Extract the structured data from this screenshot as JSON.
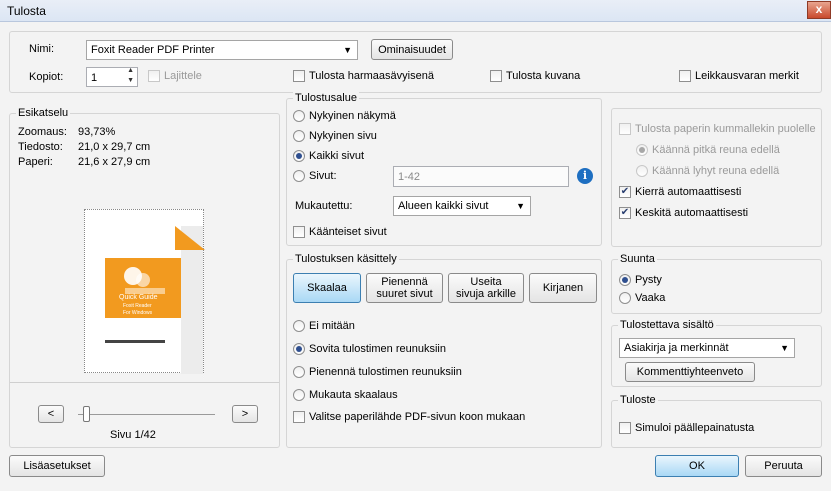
{
  "window": {
    "title": "Tulosta",
    "close": "x"
  },
  "printer": {
    "name_label": "Nimi:",
    "name_value": "Foxit Reader PDF Printer",
    "properties_button": "Ominaisuudet",
    "copies_label": "Kopiot:",
    "copies_value": "1",
    "collate_label": "Lajittele",
    "grayscale_label": "Tulosta harmaasävyisenä",
    "print_as_image_label": "Tulosta kuvana",
    "crop_marks_label": "Leikkausvaran merkit"
  },
  "preview": {
    "legend": "Esikatselu",
    "zoom_label": "Zoomaus:",
    "zoom_value": "93,73%",
    "file_label": "Tiedosto:",
    "file_value": "21,0 x 29,7 cm",
    "paper_label": "Paperi:",
    "paper_value": "21,6 x 27,9 cm",
    "cover_title": "Quick Guide",
    "cover_sub1": "Foxit Reader",
    "cover_sub2": "For Windows",
    "prev_button": "<",
    "next_button": ">",
    "page_indicator": "Sivu 1/42"
  },
  "print_range": {
    "legend": "Tulostusalue",
    "current_view": "Nykyinen näkymä",
    "current_page": "Nykyinen sivu",
    "all_pages": "Kaikki sivut",
    "pages_label": "Sivut:",
    "pages_value": "1-42",
    "custom_label": "Mukautettu:",
    "custom_value": "Alueen kaikki sivut",
    "reverse_pages": "Käänteiset sivut"
  },
  "handling": {
    "legend": "Tulostuksen käsittely",
    "tab_scale": "Skaalaa",
    "tab_shrink": "Pienennä suuret sivut",
    "tab_multiple": "Useita sivuja arkille",
    "tab_booklet": "Kirjanen",
    "opt_none": "Ei mitään",
    "opt_fit": "Sovita tulostimen reunuksiin",
    "opt_shrink": "Pienennä tulostimen reunuksiin",
    "opt_custom": "Mukauta skaalaus",
    "paper_source": "Valitse paperilähde PDF-sivun koon mukaan"
  },
  "duplex": {
    "both_sides": "Tulosta paperin kummallekin puolelle",
    "long_edge": "Käännä pitkä reuna edellä",
    "short_edge": "Käännä lyhyt reuna edellä",
    "auto_rotate": "Kierrä automaattisesti",
    "auto_center": "Keskitä automaattisesti"
  },
  "orientation": {
    "legend": "Suunta",
    "portrait": "Pysty",
    "landscape": "Vaaka"
  },
  "content": {
    "legend": "Tulostettava sisältö",
    "value": "Asiakirja ja merkinnät",
    "summary_button": "Kommenttiyhteenveto"
  },
  "output": {
    "legend": "Tuloste",
    "simulate_overprint": "Simuloi päällepainatusta"
  },
  "footer": {
    "advanced_button": "Lisäasetukset",
    "ok_button": "OK",
    "cancel_button": "Peruuta"
  },
  "colors": {
    "accent": "#f29a1f",
    "info_icon": "#1e6fc1"
  }
}
